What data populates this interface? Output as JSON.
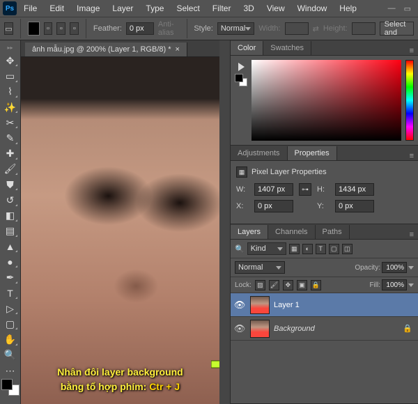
{
  "menu": [
    "File",
    "Edit",
    "Image",
    "Layer",
    "Type",
    "Select",
    "Filter",
    "3D",
    "View",
    "Window",
    "Help"
  ],
  "options": {
    "feather_label": "Feather:",
    "feather_value": "0 px",
    "antialias": "Anti-alias",
    "style_label": "Style:",
    "style_value": "Normal",
    "width_label": "Width:",
    "height_label": "Height:",
    "select_all": "Select and"
  },
  "doc": {
    "tab": "ảnh mẫu.jpg @ 200% (Layer 1, RGB/8) *"
  },
  "annotation": {
    "line1": "Nhân đôi layer background",
    "line2_a": "bằng tổ hợp phím: ",
    "line2_b": "Ctr + J"
  },
  "color_panel": {
    "tabs": [
      "Color",
      "Swatches"
    ]
  },
  "props_panel": {
    "tabs": [
      "Adjustments",
      "Properties"
    ],
    "title": "Pixel Layer Properties",
    "w_label": "W:",
    "w_value": "1407 px",
    "h_label": "H:",
    "h_value": "1434 px",
    "x_label": "X:",
    "x_value": "0 px",
    "y_label": "Y:",
    "y_value": "0 px"
  },
  "layers_panel": {
    "tabs": [
      "Layers",
      "Channels",
      "Paths"
    ],
    "kind": "Kind",
    "blend": "Normal",
    "opacity_label": "Opacity:",
    "opacity_value": "100%",
    "lock_label": "Lock:",
    "fill_label": "Fill:",
    "fill_value": "100%",
    "items": [
      {
        "name": "Layer 1",
        "locked": false,
        "selected": true
      },
      {
        "name": "Background",
        "locked": true,
        "selected": false
      }
    ]
  },
  "tools": [
    "move",
    "marquee",
    "lasso",
    "wand",
    "crop",
    "eyedropper",
    "heal",
    "brush",
    "stamp",
    "history",
    "eraser",
    "gradient",
    "blur",
    "dodge",
    "pen",
    "type",
    "path",
    "rect",
    "hand",
    "zoom"
  ]
}
